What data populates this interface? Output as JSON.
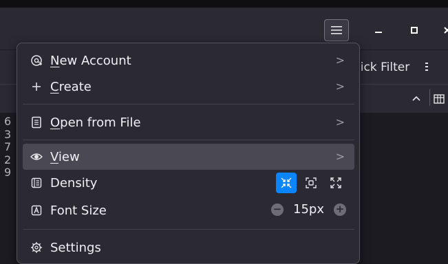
{
  "window": {
    "controls": {
      "minimize_icon": "minimize-icon",
      "maximize_icon": "maximize-icon",
      "close_icon": "close-icon"
    }
  },
  "toolbar": {
    "quick_filter_label": "uick Filter"
  },
  "list": {
    "left_digits": [
      "6",
      "3",
      "7",
      "2",
      "9"
    ]
  },
  "menu": {
    "items": [
      {
        "pre": "",
        "ul": "N",
        "post": "ew Account",
        "icon": "new-account-icon",
        "chevron": ">"
      },
      {
        "pre": "",
        "ul": "C",
        "post": "reate",
        "icon": "plus-icon",
        "chevron": ">"
      },
      {
        "pre": "",
        "ul": "O",
        "post": "pen from File",
        "icon": "file-icon",
        "chevron": ">"
      },
      {
        "pre": "",
        "ul": "V",
        "post": "iew",
        "icon": "eye-icon",
        "chevron": ">"
      },
      {
        "label": "Density",
        "icon": "density-icon"
      },
      {
        "label": "Font Size",
        "icon": "font-size-icon"
      },
      {
        "label": "Settings",
        "icon": "settings-gear-icon"
      }
    ],
    "font_size": {
      "value": "15px",
      "decrease": "−",
      "increase": "+"
    },
    "density_selected": "compact"
  },
  "colors": {
    "accent": "#0a84ff",
    "menu_bg": "#2b2a33",
    "hover_bg": "#4a4953"
  }
}
